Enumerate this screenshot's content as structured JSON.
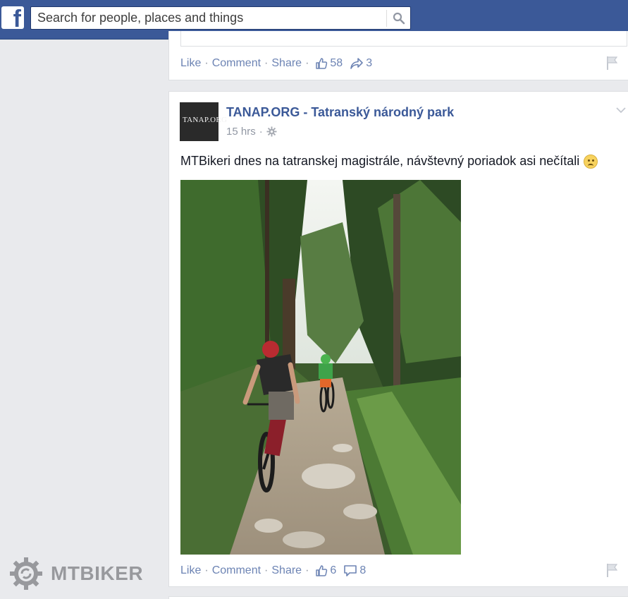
{
  "topbar": {
    "logo_letter": "f",
    "search_placeholder": "Search for people, places and things"
  },
  "previous_post": {
    "actions": {
      "like": "Like",
      "comment": "Comment",
      "share": "Share"
    },
    "like_count": "58",
    "share_count": "3"
  },
  "post": {
    "page_name": "TANAP.ORG - Tatranský národný park",
    "avatar_text": "TANAP.ORG",
    "time": "15 hrs",
    "privacy_icon": "gear-icon",
    "text": "MTBikeri dnes na tatranskej magistrále, návštevný poriadok asi nečítali",
    "emoji": "frown-emoji",
    "actions": {
      "like": "Like",
      "comment": "Comment",
      "share": "Share"
    },
    "like_count": "6",
    "comment_count": "8"
  },
  "watermark": {
    "text": "MTBIKER"
  },
  "colors": {
    "brand_blue": "#3b5998",
    "link_blue": "#6d84b4",
    "background": "#e9eaed"
  }
}
